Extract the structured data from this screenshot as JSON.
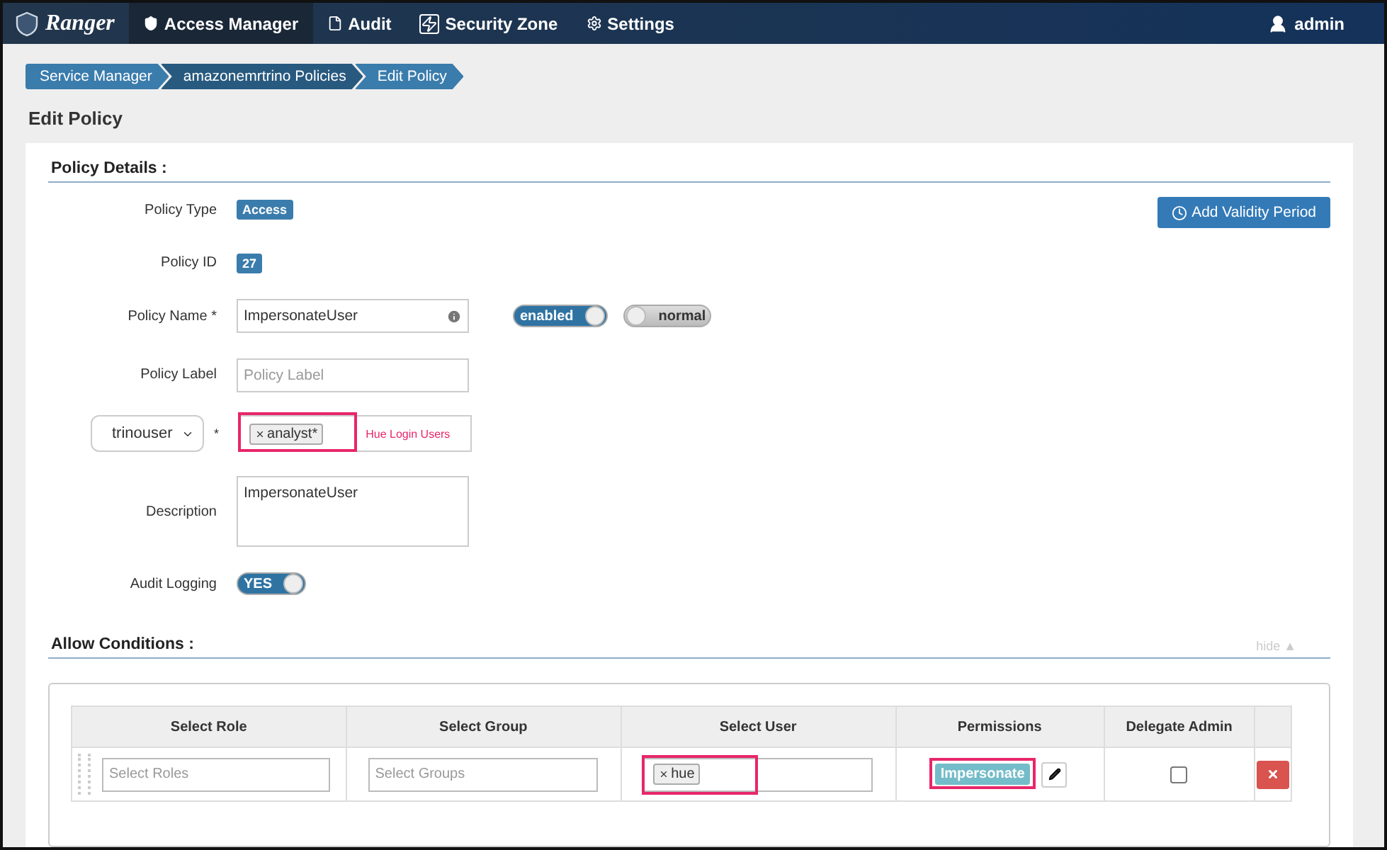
{
  "navbar": {
    "brand": "Ranger",
    "items": [
      {
        "label": "Access Manager",
        "selected": true
      },
      {
        "label": "Audit",
        "selected": false
      },
      {
        "label": "Security Zone",
        "selected": false
      },
      {
        "label": "Settings",
        "selected": false
      }
    ],
    "user": "admin"
  },
  "breadcrumb": [
    "Service Manager",
    "amazonemrtrino Policies",
    "Edit Policy"
  ],
  "page_title": "Edit Policy",
  "policy_details": {
    "title": "Policy Details :",
    "add_validity_button": "Add Validity Period",
    "policy_type": {
      "label": "Policy Type",
      "value": "Access"
    },
    "policy_id": {
      "label": "Policy ID",
      "value": "27"
    },
    "policy_name": {
      "label": "Policy Name *",
      "value": "ImpersonateUser",
      "toggles": [
        {
          "label": "enabled",
          "on": true
        },
        {
          "label": "normal",
          "on": false
        }
      ]
    },
    "policy_label": {
      "label": "Policy Label",
      "placeholder": "Policy Label"
    },
    "resource": {
      "select": "trinouser",
      "required": "*",
      "tags": [
        "analyst*"
      ],
      "hint": "Hue Login Users",
      "highlighted": true
    },
    "description": {
      "label": "Description",
      "value": "ImpersonateUser"
    },
    "audit_logging": {
      "label": "Audit Logging",
      "toggle": {
        "label": "YES",
        "on": true
      }
    }
  },
  "allow_conditions": {
    "title": "Allow Conditions :",
    "hide_link": "hide ▲",
    "columns": [
      "Select Role",
      "Select Group",
      "Select User",
      "Permissions",
      "Delegate Admin"
    ],
    "rows": [
      {
        "roles_placeholder": "Select Roles",
        "groups_placeholder": "Select Groups",
        "users": [
          "hue"
        ],
        "users_highlighted": true,
        "permissions": [
          "Impersonate"
        ],
        "permissions_highlighted": true,
        "delegate_admin": false
      }
    ]
  }
}
